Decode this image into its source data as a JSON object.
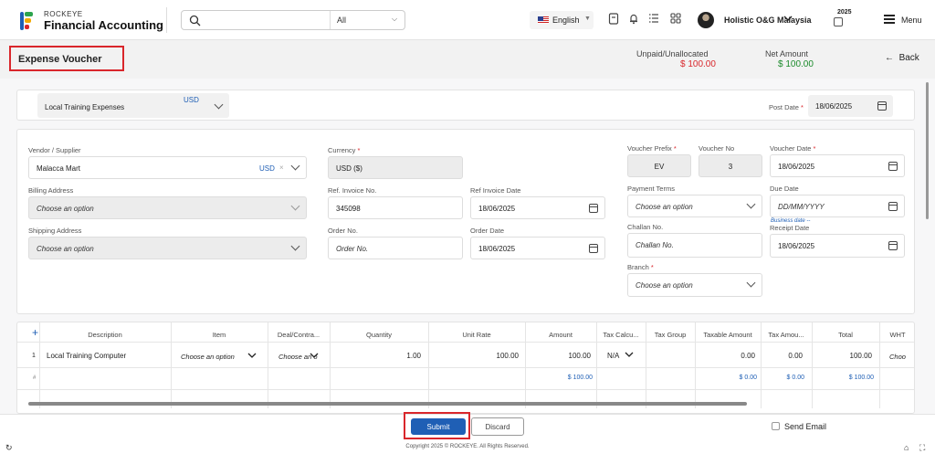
{
  "app": {
    "brand_top": "ROCKEYE",
    "brand_main": "Financial Accounting"
  },
  "topbar": {
    "search_placeholder": "",
    "search_scope": "All",
    "language": "English",
    "company": "Holistic O&G Malaysia",
    "year": "2025",
    "menu_label": "Menu"
  },
  "header": {
    "title": "Expense Voucher",
    "unpaid_label": "Unpaid/Unallocated",
    "unpaid_value": "$ 100.00",
    "net_label": "Net Amount",
    "net_value": "$ 100.00",
    "back_label": "Back"
  },
  "colors": {
    "accent": "#1f5fb5",
    "danger": "#d9262b",
    "success": "#1a8a2a"
  },
  "top_card": {
    "expense_type": "Local Training Expenses",
    "currency_tag": "USD",
    "post_date_label": "Post Date",
    "post_date": "18/06/2025"
  },
  "form": {
    "vendor_label": "Vendor / Supplier",
    "vendor_value": "Malacca Mart",
    "vendor_currency": "USD",
    "billing_label": "Billing Address",
    "billing_placeholder": "Choose an option",
    "shipping_label": "Shipping Address",
    "shipping_placeholder": "Choose an option",
    "currency_label": "Currency",
    "currency_value": "USD ($)",
    "ref_invoice_label": "Ref. Invoice No.",
    "ref_invoice_value": "345098",
    "ref_invoice_date_label": "Ref Invoice Date",
    "ref_invoice_date": "18/06/2025",
    "order_no_label": "Order No.",
    "order_no_placeholder": "Order No.",
    "order_date_label": "Order Date",
    "order_date": "18/06/2025",
    "voucher_prefix_label": "Voucher Prefix",
    "voucher_prefix": "EV",
    "voucher_no_label": "Voucher No",
    "voucher_no": "3",
    "voucher_date_label": "Voucher Date",
    "voucher_date": "18/06/2025",
    "payment_terms_label": "Payment Terms",
    "payment_terms_placeholder": "Choose an option",
    "due_date_label": "Due Date",
    "due_date_placeholder": "DD/MM/YYYY",
    "business_date_hint": "Business date --",
    "challan_label": "Challan No.",
    "challan_placeholder": "Challan No.",
    "receipt_date_label": "Receipt Date",
    "receipt_date": "18/06/2025",
    "branch_label": "Branch",
    "branch_placeholder": "Choose an option"
  },
  "table": {
    "add_icon": "plus-icon",
    "headers": [
      "Description",
      "Item",
      "Deal/Contra...",
      "Quantity",
      "Unit Rate",
      "Amount",
      "Tax Calcu...",
      "Tax Group",
      "Taxable Amount",
      "Tax Amou...",
      "Total",
      "WHT"
    ],
    "row": {
      "index": "1",
      "description": "Local Training Computer",
      "item": "Choose an option",
      "deal": "Choose an o",
      "quantity": "1.00",
      "unit_rate": "100.00",
      "amount": "100.00",
      "tax_calc": "N/A",
      "taxable_amount": "0.00",
      "tax_amount": "0.00",
      "total": "100.00",
      "wht": "Choo"
    },
    "totals": {
      "hash": "#",
      "amount": "$ 100.00",
      "taxable_amount": "$ 0.00",
      "tax_amount": "$ 0.00",
      "total": "$ 100.00"
    }
  },
  "footer": {
    "submit_label": "Submit",
    "discard_label": "Discard",
    "send_email_label": "Send Email",
    "copyright": "Copyright 2025 © ROCKEYE. All Rights Reserved."
  }
}
